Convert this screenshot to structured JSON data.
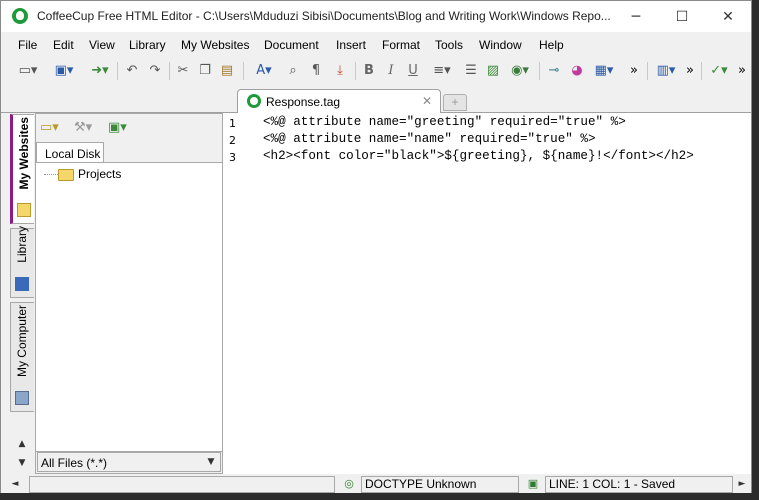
{
  "window": {
    "title": "CoffeeCup Free HTML Editor - C:\\Users\\Mduduzi Sibisi\\Documents\\Blog and Writing Work\\Windows Repo...",
    "minimize": "─",
    "maximize": "☐",
    "close": "✕"
  },
  "menu": [
    "File",
    "Edit",
    "View",
    "Library",
    "My Websites",
    "Document",
    "Insert",
    "Format",
    "Tools",
    "Window",
    "Help"
  ],
  "toolbar": {
    "more_1": "»",
    "more_2": "»",
    "more_3": "»",
    "bold": "B",
    "italic": "I",
    "underline": "U",
    "paragraph": "¶"
  },
  "editor_tab": {
    "label": "Response.tag",
    "close": "✕",
    "new_tab": "+"
  },
  "side_tabs": {
    "my_websites": "My Websites",
    "library": "Library",
    "my_computer": "My Computer",
    "scroll_up": "▲",
    "scroll_down": "▼"
  },
  "files_panel": {
    "tab": "Local Disk",
    "tree_items": [
      "Projects"
    ],
    "filter": "All Files (*.*)",
    "filter_arrow": "▼"
  },
  "editor": {
    "lines": [
      {
        "number": "1",
        "text": "<%@ attribute name=\"greeting\" required=\"true\" %>"
      },
      {
        "number": "2",
        "text": "<%@ attribute name=\"name\" required=\"true\" %>"
      },
      {
        "number": "3",
        "text": "<h2><font color=\"black\">${greeting}, ${name}!</font></h2>"
      }
    ]
  },
  "status": {
    "left_arrow": "◄",
    "doctype": "DOCTYPE Unknown",
    "position": "LINE: 1  COL: 1 - Saved",
    "right_arrow": "►"
  },
  "colors": {
    "accent": "#8b1a8b",
    "app_green": "#1f9a3a",
    "folder": "#f5d66b"
  }
}
